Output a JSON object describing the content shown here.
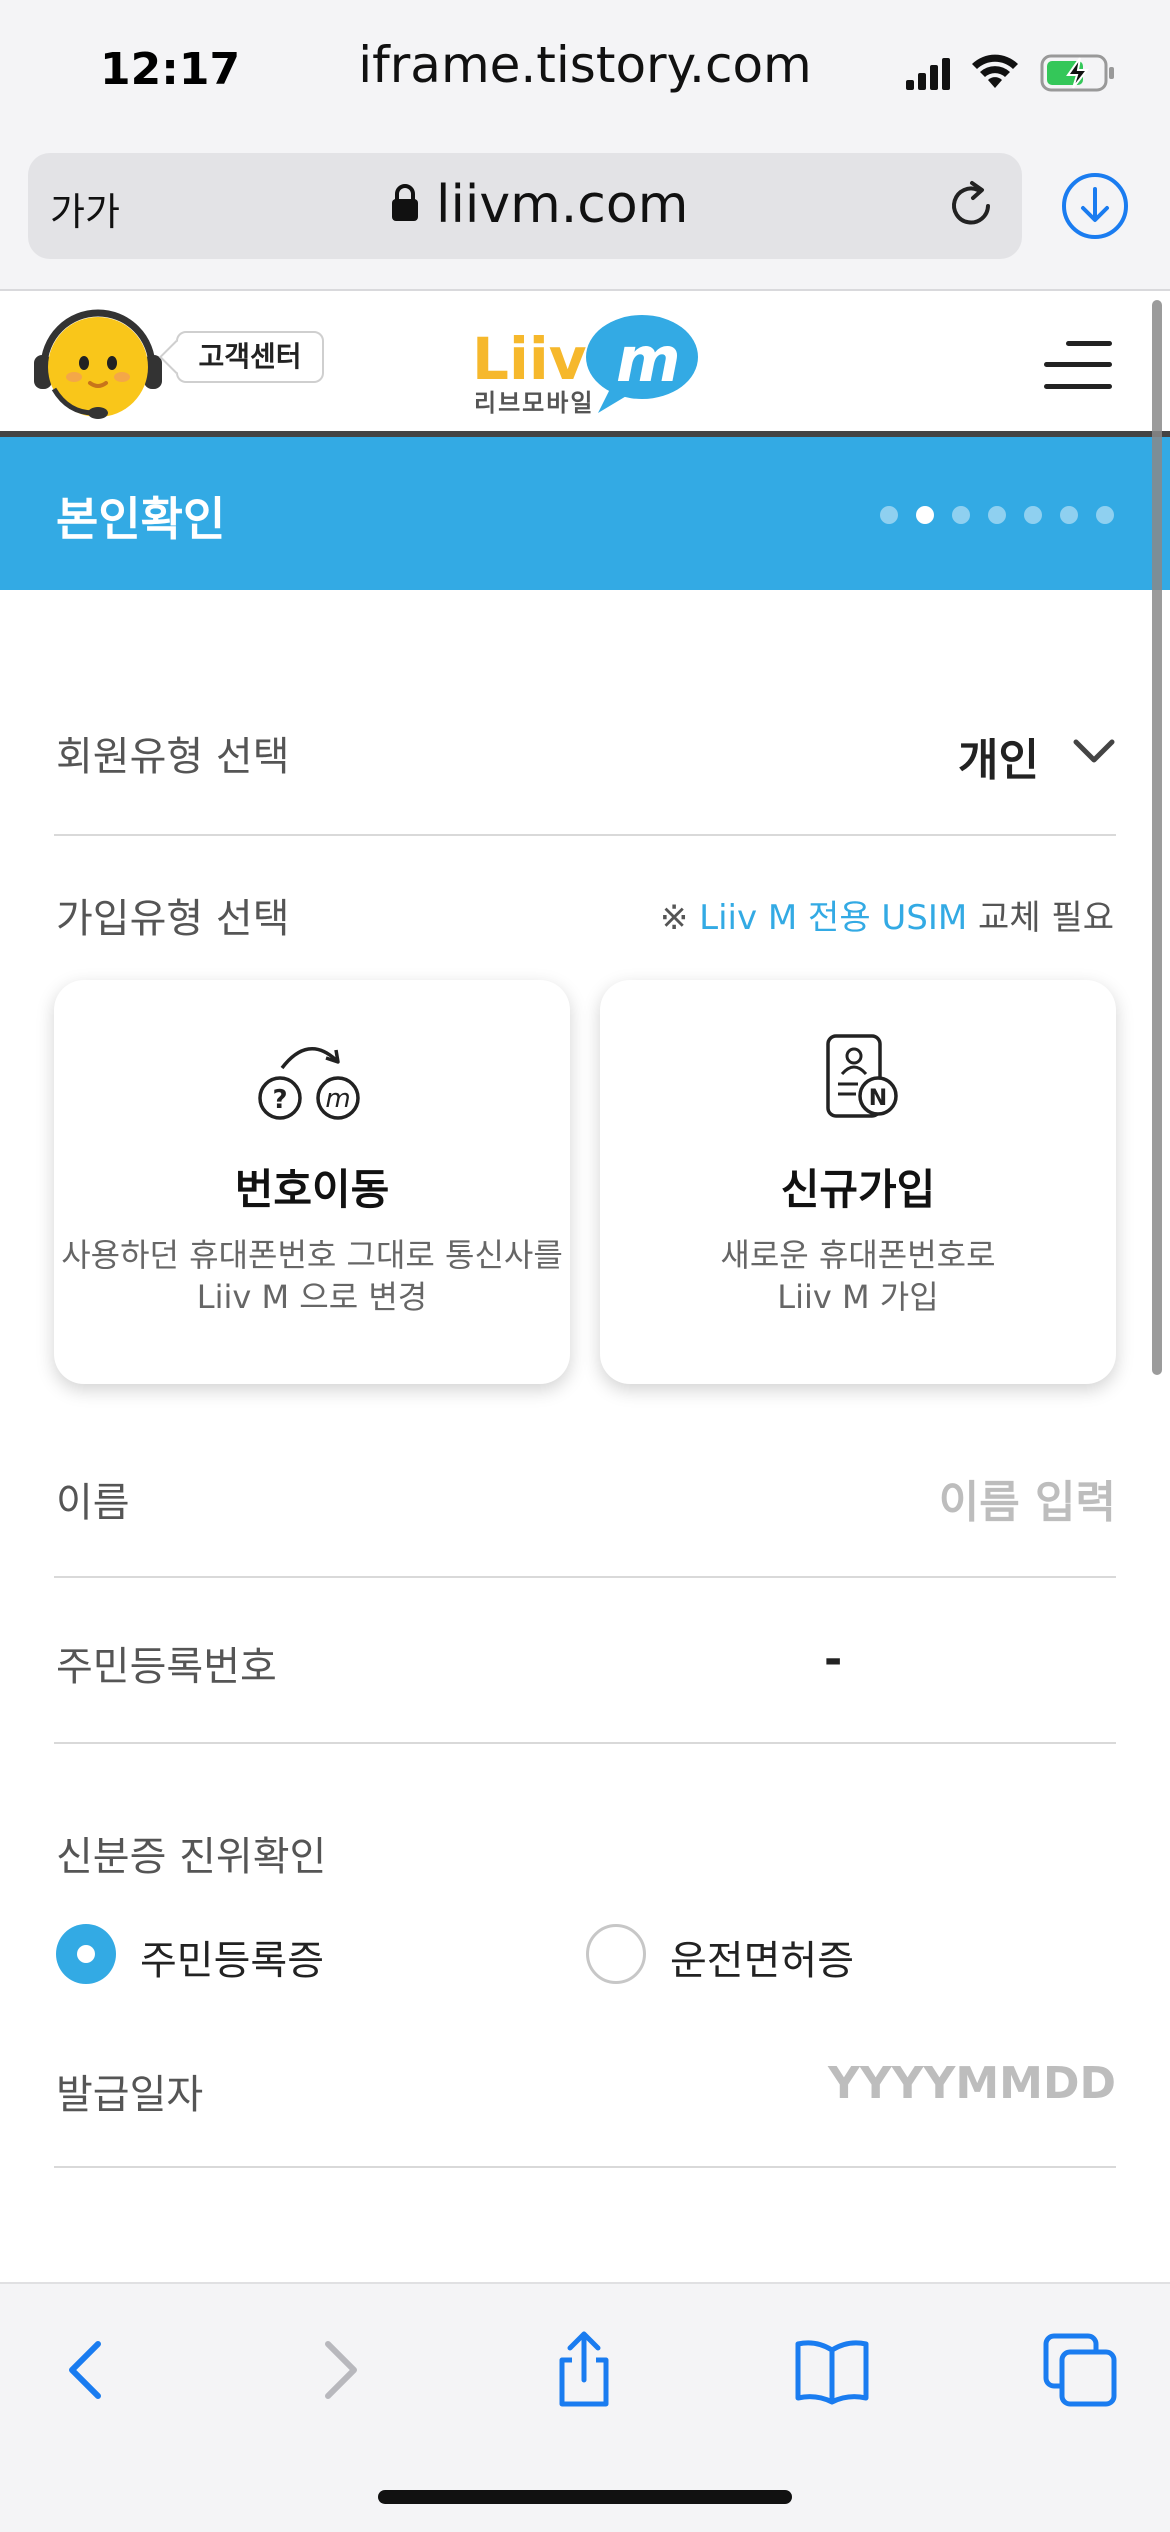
{
  "status_bar": {
    "time": "12:17",
    "host": "iframe.tistory.com"
  },
  "url_bar": {
    "text_size_label": "가가",
    "domain": "liivm.com"
  },
  "site_header": {
    "customer_center": "고객센터",
    "logo_text": "Liiv m",
    "logo_sub": "리브모바일"
  },
  "band": {
    "title": "본인확인",
    "step_count": 7,
    "active_step": 2
  },
  "form": {
    "member_type_label": "회원유형 선택",
    "member_type_value": "개인",
    "join_type_label": "가입유형 선택",
    "note_prefix": "※ ",
    "note_highlight": "Liiv M 전용 USIM",
    "note_suffix": " 교체 필요",
    "cards": [
      {
        "title": "번호이동",
        "desc_line1": "사용하던 휴대폰번호 그대로 통신사를",
        "desc_line2": "Liiv M 으로 변경",
        "icon": "number-transfer-icon"
      },
      {
        "title": "신규가입",
        "desc_line1": "새로운 휴대폰번호로",
        "desc_line2": "Liiv M 가입",
        "icon": "new-subscription-icon"
      }
    ],
    "name_label": "이름",
    "name_placeholder": "이름 입력",
    "rrn_label": "주민등록번호",
    "rrn_separator": "-",
    "id_verify_label": "신분증 진위확인",
    "id_options": [
      "주민등록증",
      "운전면허증"
    ],
    "id_selected": 0,
    "issue_date_label": "발급일자",
    "issue_date_placeholder": "YYYYMMDD"
  },
  "colors": {
    "accent": "#33aae4",
    "logo_yellow": "#f6b82c"
  },
  "toolbar_icons": [
    "back-icon",
    "forward-icon",
    "share-icon",
    "bookmarks-icon",
    "tabs-icon"
  ]
}
